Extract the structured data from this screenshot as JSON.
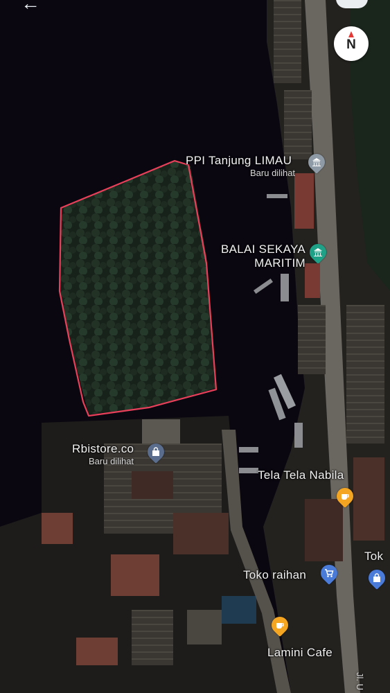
{
  "nav": {
    "back_icon": "arrow-left-icon"
  },
  "compass": {
    "letter": "N"
  },
  "pois": [
    {
      "key": "ppi",
      "name": "PPI Tanjung LIMAU",
      "sub": "Baru dilihat",
      "icon": "museum-icon",
      "color": "#8e9aa6"
    },
    {
      "key": "balai",
      "name_line1": "BALAI SEKAYA",
      "name_line2": "MARITIM",
      "icon": "museum-icon",
      "color": "#1fa187"
    },
    {
      "key": "rbistore",
      "name": "Rbistore.co",
      "sub": "Baru dilihat",
      "icon": "shopping-bag-icon",
      "color": "#5a6d8c"
    },
    {
      "key": "tela",
      "name": "Tela Tela Nabila",
      "icon": "cafe-icon",
      "color": "#f4a623"
    },
    {
      "key": "toko",
      "name": "Toko raihan",
      "icon": "shopping-cart-icon",
      "color": "#4a7bd9"
    },
    {
      "key": "tok",
      "name": "Tok",
      "icon": "shopping-bag-icon",
      "color": "#4a7bd9"
    },
    {
      "key": "lamini",
      "name": "Lamini Cafe",
      "icon": "cafe-icon",
      "color": "#f4a623"
    }
  ],
  "road_label": "Jl. U",
  "colors": {
    "water": "#0b0710",
    "outline": "#e8405a"
  }
}
